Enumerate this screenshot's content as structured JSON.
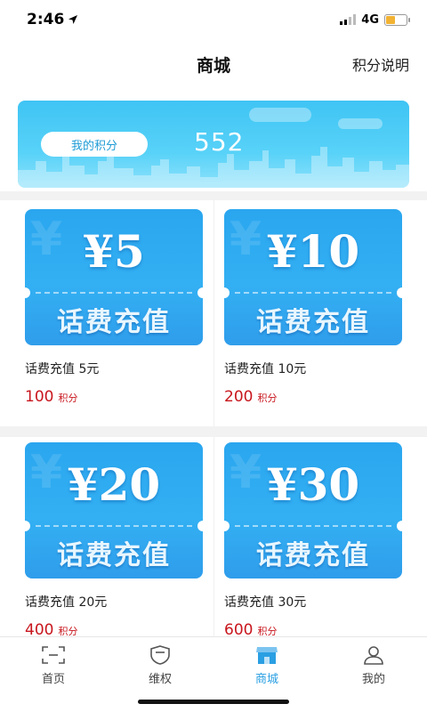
{
  "status_bar": {
    "time": "2:46",
    "network": "4G"
  },
  "header": {
    "title": "商城",
    "action": "积分说明"
  },
  "points": {
    "label": "我的积分",
    "value": "552"
  },
  "products": [
    {
      "coupon_amount": "¥5",
      "coupon_type": "话费充值",
      "name": "话费充值 5元",
      "price": "100",
      "price_unit": "积分"
    },
    {
      "coupon_amount": "¥10",
      "coupon_type": "话费充值",
      "name": "话费充值 10元",
      "price": "200",
      "price_unit": "积分"
    },
    {
      "coupon_amount": "¥20",
      "coupon_type": "话费充值",
      "name": "话费充值 20元",
      "price": "400",
      "price_unit": "积分"
    },
    {
      "coupon_amount": "¥30",
      "coupon_type": "话费充值",
      "name": "话费充值 30元",
      "price": "600",
      "price_unit": "积分"
    }
  ],
  "tabbar": {
    "items": [
      {
        "label": "首页",
        "icon": "scan-frame-icon",
        "active": false
      },
      {
        "label": "维权",
        "icon": "shield-icon",
        "active": false
      },
      {
        "label": "商城",
        "icon": "store-icon",
        "active": true
      },
      {
        "label": "我的",
        "icon": "user-icon",
        "active": false
      }
    ]
  },
  "colors": {
    "accent": "#2a9fe3",
    "price": "#c8161d",
    "banner": "#3fc4f4",
    "coupon": "#2aa6ef"
  }
}
